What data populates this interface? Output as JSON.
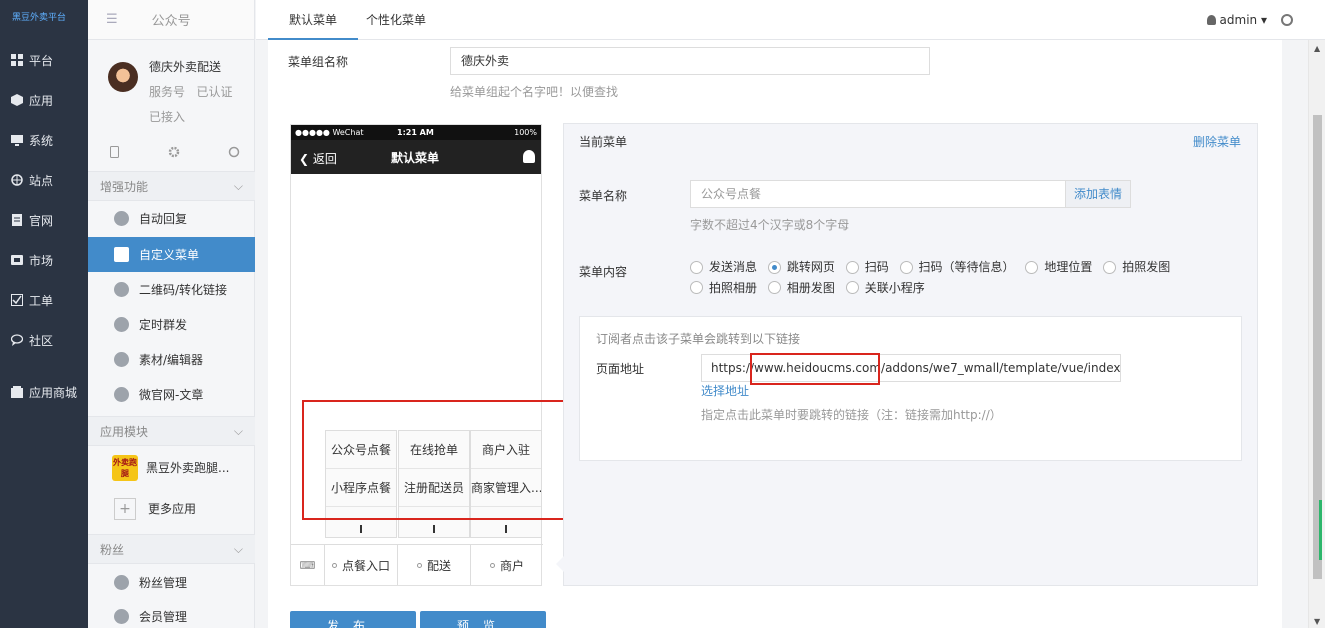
{
  "brand": {
    "logo_text": "黑豆外卖平台"
  },
  "nav": [
    {
      "label": "平台",
      "icon": "grid-icon"
    },
    {
      "label": "应用",
      "icon": "cube-icon"
    },
    {
      "label": "系统",
      "icon": "monitor-icon"
    },
    {
      "label": "站点",
      "icon": "globe-icon"
    },
    {
      "label": "官网",
      "icon": "document-icon"
    },
    {
      "label": "市场",
      "icon": "store-icon"
    },
    {
      "label": "工单",
      "icon": "check-square-icon"
    },
    {
      "label": "社区",
      "icon": "chat-icon"
    },
    {
      "label": "应用商城",
      "icon": "shop-icon"
    }
  ],
  "sidebar": {
    "header_title": "公众号",
    "account": {
      "name": "德庆外卖配送",
      "type": "服务号",
      "verified": "已认证",
      "status": "已接入"
    },
    "sections": {
      "enhance": "增强功能",
      "modules": "应用模块",
      "fans": "粉丝"
    },
    "items": [
      {
        "label": "自动回复"
      },
      {
        "label": "自定义菜单"
      },
      {
        "label": "二维码/转化链接"
      },
      {
        "label": "定时群发"
      },
      {
        "label": "素材/编辑器"
      },
      {
        "label": "微官网-文章"
      }
    ],
    "app_module": {
      "badge": "外卖跑腿",
      "label": "黑豆外卖跑腿..."
    },
    "more_apps": "更多应用",
    "fans_items": [
      {
        "label": "粉丝管理"
      },
      {
        "label": "会员管理"
      }
    ]
  },
  "topbar": {
    "tabs": [
      {
        "label": "默认菜单"
      },
      {
        "label": "个性化菜单"
      }
    ],
    "user": "admin"
  },
  "form": {
    "group_name_label": "菜单组名称",
    "group_name_value": "德庆外卖",
    "group_name_hint": "给菜单组起个名字吧！以便查找"
  },
  "phone": {
    "carrier": "●●●●● WeChat",
    "time": "1:21 AM",
    "battery": "100%",
    "back": "返回",
    "title": "默认菜单",
    "keyboard_icon": "keyboard-icon",
    "submenus": [
      {
        "top": "公众号点餐",
        "bottom": "小程序点餐"
      },
      {
        "top": "在线抢单",
        "bottom": "注册配送员"
      },
      {
        "top": "商户入驻",
        "bottom": "商家管理入..."
      }
    ],
    "bottom_menus": [
      "点餐入口",
      "配送",
      "商户"
    ]
  },
  "panel": {
    "current_label": "当前菜单",
    "delete": "删除菜单",
    "name_label": "菜单名称",
    "name_value": "公众号点餐",
    "emoji_button": "添加表情",
    "name_hint": "字数不超过4个汉字或8个字母",
    "content_label": "菜单内容",
    "options": [
      {
        "label": "发送消息",
        "checked": false
      },
      {
        "label": "跳转网页",
        "checked": true
      },
      {
        "label": "扫码",
        "checked": false
      },
      {
        "label": "扫码（等待信息）",
        "checked": false
      },
      {
        "label": "地理位置",
        "checked": false
      },
      {
        "label": "拍照发图",
        "checked": false
      },
      {
        "label": "拍照相册",
        "checked": false
      },
      {
        "label": "相册发图",
        "checked": false
      },
      {
        "label": "关联小程序",
        "checked": false
      }
    ],
    "link_intro": "订阅者点击该子菜单会跳转到以下链接",
    "url_label": "页面地址",
    "url_value": "https://www.heidoucms.com/addons/we7_wmall/template/vue/index",
    "choose_link": "选择地址",
    "url_hint": "指定点击此菜单时要跳转的链接（注：链接需加http://）"
  },
  "buttons": {
    "publish": "发布",
    "preview": "预览"
  }
}
